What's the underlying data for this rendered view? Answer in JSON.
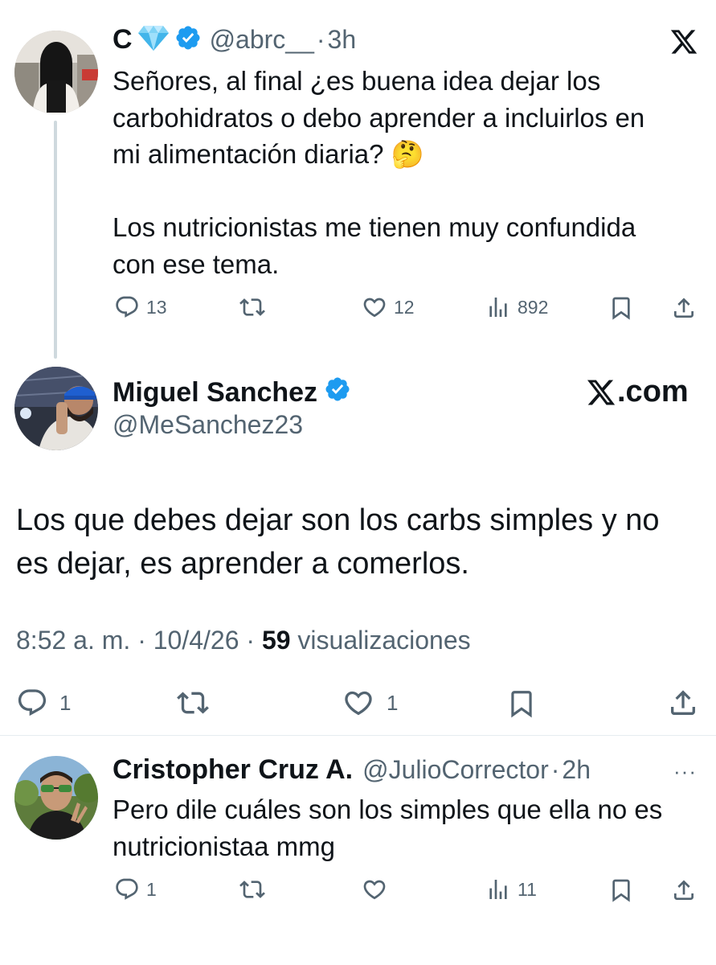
{
  "tweet1": {
    "name": "C",
    "handle": "@abrc__",
    "dot": "·",
    "time": "3h",
    "text": "Señores, al final ¿es buena idea dejar los\ncarbohidratos o debo aprender a incluirlos en\nmi alimentación diaria? 🤔\n\nLos nutricionistas me tienen muy confundida\ncon ese tema.",
    "replies": "13",
    "likes": "12",
    "views": "892"
  },
  "main": {
    "name": "Miguel Sanchez",
    "handle": "@MeSanchez23",
    "brand": ".com",
    "text": "Los que debes dejar son los carbs simples y no\nes dejar, es aprender a comerlos.",
    "time": "8:52 a. m.",
    "sep1": " · ",
    "date": "10/4/26",
    "sep2": " · ",
    "view_count": "59",
    "views_label": " visualizaciones",
    "replies": "1",
    "likes": "1"
  },
  "tweet3": {
    "name": "Cristopher Cruz A.",
    "handle": "@JulioCorrector",
    "dot": "·",
    "time": "2h",
    "more": "···",
    "text": "Pero dile cuáles son los simples que ella no es\nnutricionistaa mmg",
    "replies": "1",
    "views": "11"
  },
  "colors": {
    "verified": "#1d9bf0",
    "secondary_text": "#536471",
    "primary_text": "#0f1419"
  }
}
